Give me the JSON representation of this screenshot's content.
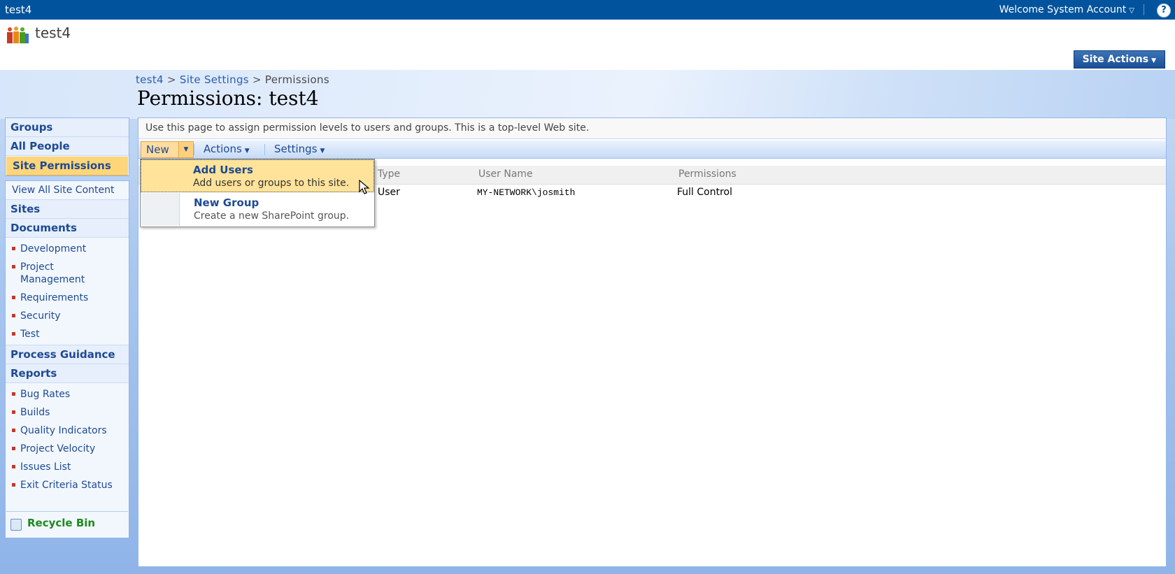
{
  "topbar": {
    "site_name": "test4",
    "welcome": "Welcome System Account",
    "help_label": "?"
  },
  "header": {
    "site_title": "test4",
    "site_actions": "Site Actions"
  },
  "breadcrumb": {
    "items": [
      "test4",
      "Site Settings",
      "Permissions"
    ],
    "separator": ">"
  },
  "page_title": "Permissions: test4",
  "nav": {
    "group1": [
      {
        "label": "Groups"
      },
      {
        "label": "All People"
      },
      {
        "label": "Site Permissions",
        "selected": true
      }
    ],
    "view_all": "View All Site Content",
    "sites": "Sites",
    "documents": "Documents",
    "document_items": [
      "Development",
      "Project Management",
      "Requirements",
      "Security",
      "Test"
    ],
    "process_guidance": "Process Guidance",
    "reports": "Reports",
    "report_items": [
      "Bug Rates",
      "Builds",
      "Quality Indicators",
      "Project Velocity",
      "Issues List",
      "Exit Criteria Status"
    ],
    "recycle_bin": "Recycle Bin"
  },
  "content": {
    "description": "Use this page to assign permission levels to users and groups. This is a top-level Web site.",
    "toolbar": {
      "new": "New",
      "actions": "Actions",
      "settings": "Settings"
    },
    "columns": [
      "Type",
      "User Name",
      "Permissions"
    ],
    "rows": [
      {
        "type": "User",
        "user_name": "MY-NETWORK\\josmith",
        "permissions": "Full Control"
      }
    ]
  },
  "menu": {
    "items": [
      {
        "title": "Add Users",
        "description": "Add users or groups to this site."
      },
      {
        "title": "New Group",
        "description": "Create a new SharePoint group."
      }
    ]
  },
  "colors": {
    "topbar": "#00539c",
    "selected_nav": "#ffd57a",
    "menu_highlight": "#ffe39a",
    "recycle_green": "#1c8a1c"
  }
}
